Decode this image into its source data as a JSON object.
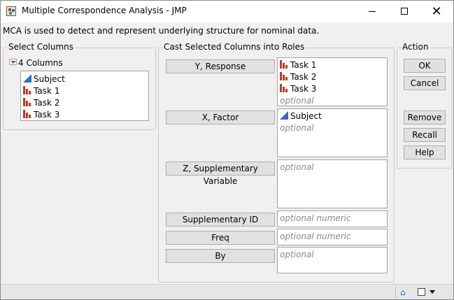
{
  "window": {
    "title": "Multiple Correspondence Analysis - JMP",
    "minimize_icon": "minimize-icon",
    "maximize_icon": "maximize-icon",
    "close_icon": "close-icon",
    "close_glyph": "✕"
  },
  "description": "MCA is used to detect and represent underlying structure for nominal data.",
  "select_columns": {
    "label": "Select Columns",
    "count_label": "4 Columns",
    "columns": [
      {
        "name": "Subject",
        "type": "continuous"
      },
      {
        "name": "Task 1",
        "type": "nominal"
      },
      {
        "name": "Task 2",
        "type": "nominal"
      },
      {
        "name": "Task 3",
        "type": "nominal"
      }
    ]
  },
  "cast": {
    "label": "Cast Selected Columns into Roles",
    "roles": [
      {
        "button": "Y, Response",
        "items": [
          "Task 1",
          "Task 2",
          "Task 3"
        ],
        "placeholder": "optional"
      },
      {
        "button": "X, Factor",
        "items": [
          "Subject"
        ],
        "placeholder": "optional"
      },
      {
        "button": "Z, Supplementary Variable",
        "items": [],
        "placeholder": "optional"
      },
      {
        "button": "Supplementary ID",
        "items": [],
        "placeholder": "optional numeric"
      },
      {
        "button": "Freq",
        "items": [],
        "placeholder": "optional numeric"
      },
      {
        "button": "By",
        "items": [],
        "placeholder": "optional"
      }
    ]
  },
  "action": {
    "label": "Action",
    "ok": "OK",
    "cancel": "Cancel",
    "remove": "Remove",
    "recall": "Recall",
    "help": "Help"
  },
  "statusbar": {
    "home_icon": "home-icon",
    "home_glyph": "⌂",
    "window_icon": "window-list-icon",
    "dropdown_icon": "dropdown-arrow-icon"
  },
  "colors": {
    "nominal": "#c0392b",
    "continuous": "#2e6fc4"
  }
}
